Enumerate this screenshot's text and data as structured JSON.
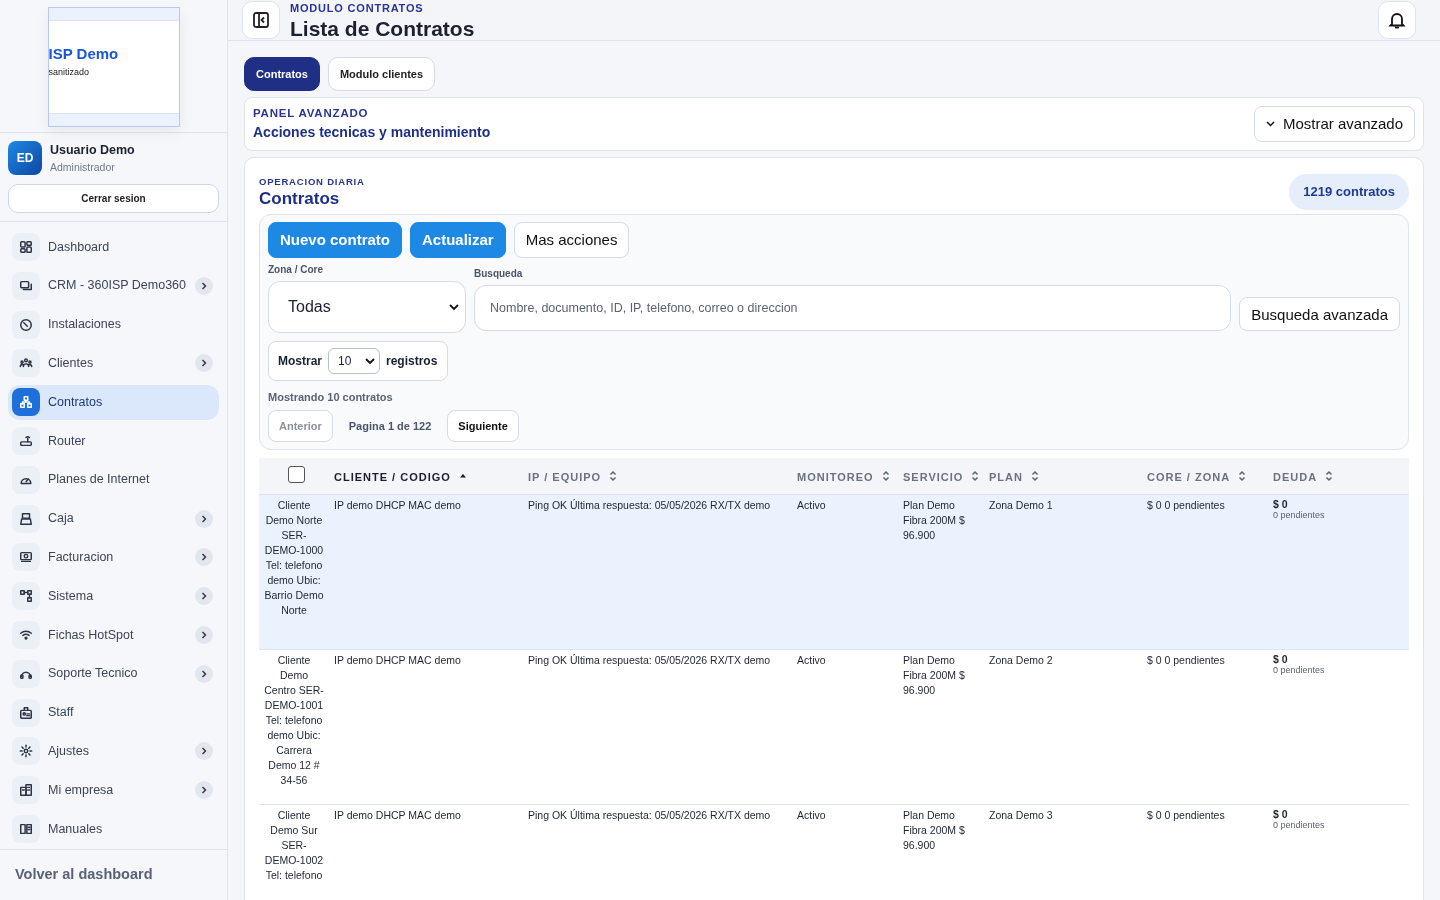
{
  "brand": {
    "title": "ISP Demo",
    "subtitle": "sanitizado"
  },
  "user": {
    "initials": "ED",
    "name": "Usuario Demo",
    "role": "Administrador",
    "logout": "Cerrar sesion"
  },
  "sidebar": {
    "items": [
      {
        "label": "Dashboard",
        "submenu": false,
        "selected": false
      },
      {
        "label": "CRM - 360ISP Demo360",
        "submenu": true,
        "selected": false
      },
      {
        "label": "Instalaciones",
        "submenu": false,
        "selected": false
      },
      {
        "label": "Clientes",
        "submenu": true,
        "selected": false
      },
      {
        "label": "Contratos",
        "submenu": false,
        "selected": true
      },
      {
        "label": "Router",
        "submenu": false,
        "selected": false
      },
      {
        "label": "Planes de Internet",
        "submenu": false,
        "selected": false
      },
      {
        "label": "Caja",
        "submenu": true,
        "selected": false
      },
      {
        "label": "Facturacion",
        "submenu": true,
        "selected": false
      },
      {
        "label": "Sistema",
        "submenu": true,
        "selected": false
      },
      {
        "label": "Fichas HotSpot",
        "submenu": true,
        "selected": false
      },
      {
        "label": "Soporte Tecnico",
        "submenu": true,
        "selected": false
      },
      {
        "label": "Staff",
        "submenu": false,
        "selected": false
      },
      {
        "label": "Ajustes",
        "submenu": true,
        "selected": false
      },
      {
        "label": "Mi empresa",
        "submenu": true,
        "selected": false
      },
      {
        "label": "Manuales",
        "submenu": false,
        "selected": false
      }
    ],
    "footer": "Volver al dashboard"
  },
  "header": {
    "eyebrow": "MODULO CONTRATOS",
    "title": "Lista de Contratos"
  },
  "tabs": [
    {
      "label": "Contratos",
      "selected": true
    },
    {
      "label": "Modulo clientes",
      "selected": false
    }
  ],
  "advanced_panel": {
    "eyebrow": "PANEL AVANZADO",
    "title": "Acciones tecnicas y mantenimiento",
    "button": "Mostrar avanzado"
  },
  "contracts": {
    "eyebrow": "OPERACION DIARIA",
    "title": "Contratos",
    "count": "1219 contratos",
    "actions": [
      {
        "label": "Nuevo contrato",
        "kind": "primary"
      },
      {
        "label": "Actualizar",
        "kind": "primary"
      },
      {
        "label": "Mas acciones",
        "kind": "outline"
      }
    ],
    "zone": {
      "label": "Zona / Core",
      "value": "Todas"
    },
    "search": {
      "label": "Busqueda",
      "placeholder": "Nombre, documento, ID, IP, telefono, correo o direccion",
      "button": "Busqueda avanzada"
    },
    "page_size": {
      "before": "Mostrar",
      "value": "10",
      "after": "registros"
    },
    "showing": "Mostrando 10 contratos",
    "pagination": {
      "prev": {
        "label": "Anterior",
        "disabled": true
      },
      "info": "Pagina 1 de 122",
      "next": {
        "label": "Siguiente",
        "disabled": false
      }
    }
  },
  "table": {
    "columns": [
      {
        "kind": "checkbox",
        "checked": false
      },
      {
        "kind": "label",
        "label": "CLIENTE / CODIGO",
        "sorted": true
      },
      {
        "kind": "label",
        "label": "IP / EQUIPO",
        "sorted": false
      },
      {
        "kind": "label",
        "label": "MONITOREO",
        "sorted": false
      },
      {
        "kind": "label",
        "label": "SERVICIO",
        "sorted": false
      },
      {
        "kind": "label",
        "label": "PLAN",
        "sorted": false
      },
      {
        "kind": "label",
        "label": "CORE / ZONA",
        "sorted": false
      },
      {
        "kind": "label",
        "label": "DEUDA",
        "sorted": false
      }
    ],
    "rows": [
      {
        "selected": true,
        "cells": [
          "Cliente Demo Norte SER-DEMO-1000 Tel: telefono demo Ubic: Barrio Demo Norte",
          "IP demo DHCP MAC demo",
          "Ping OK Última respuesta: 05/05/2026 RX/TX demo",
          "Activo",
          "Plan Demo Fibra 200M $ 96.900",
          "Zona Demo 1",
          "$ 0 0 pendientes"
        ],
        "debt": "$ 0",
        "debt_note": "0 pendientes"
      },
      {
        "selected": false,
        "cells": [
          "Cliente Demo Centro SER-DEMO-1001 Tel: telefono demo Ubic: Carrera Demo 12 # 34-56",
          "IP demo DHCP MAC demo",
          "Ping OK Última respuesta: 05/05/2026 RX/TX demo",
          "Activo",
          "Plan Demo Fibra 200M $ 96.900",
          "Zona Demo 2",
          "$ 0 0 pendientes"
        ],
        "debt": "$ 0",
        "debt_note": "0 pendientes"
      },
      {
        "selected": false,
        "cells": [
          "Cliente Demo Sur SER-DEMO-1002 Tel: telefono",
          "IP demo DHCP MAC demo",
          "Ping OK Última respuesta: 05/05/2026 RX/TX demo",
          "Activo",
          "Plan Demo Fibra 200M $ 96.900",
          "Zona Demo 3",
          "$ 0 0 pendientes"
        ],
        "debt": "$ 0",
        "debt_note": "0 pendientes"
      }
    ]
  }
}
